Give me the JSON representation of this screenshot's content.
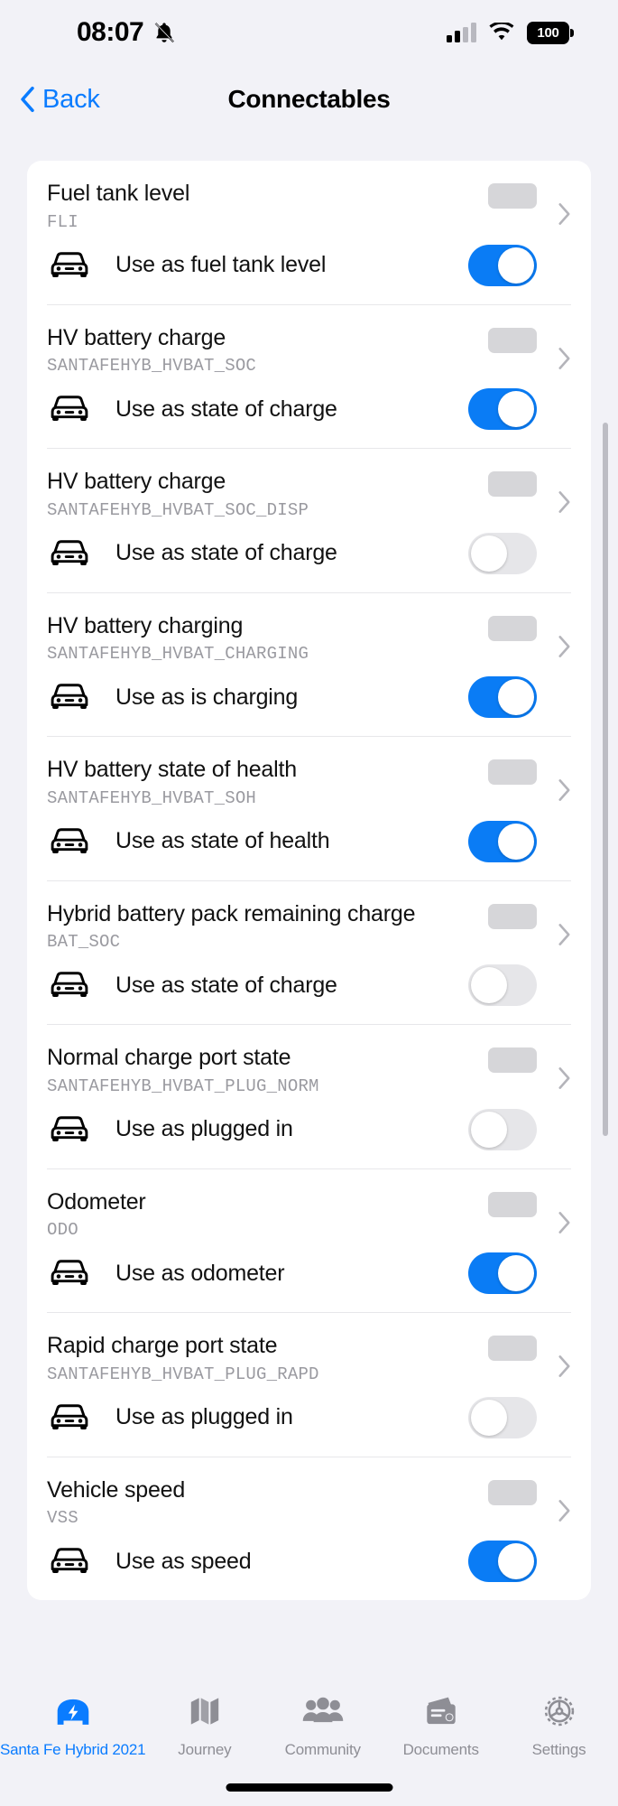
{
  "status_bar": {
    "time": "08:07",
    "bell_icon": "bell-muted-icon",
    "cellular_icon": "cellular-signal-icon",
    "wifi_icon": "wifi-icon",
    "battery_level": "100"
  },
  "nav": {
    "back_label": "Back",
    "back_icon": "chevron-left-icon",
    "title": "Connectables"
  },
  "colors": {
    "accent": "#0a7cff",
    "toggle_on": "#0a7cf5",
    "toggle_off": "#e6e6e9",
    "page_background": "#f2f2f7",
    "card_background": "#ffffff",
    "code_text": "#9a9aa0",
    "skeleton": "#d6d6d9"
  },
  "list": {
    "entries": [
      {
        "title": "Fuel tank level",
        "code": "FLI",
        "row_icon": "car-front-icon",
        "row_label": "Use as fuel tank level",
        "toggle": "on",
        "chevron": "chevron-right-icon"
      },
      {
        "title": "HV battery charge",
        "code": "SANTAFEHYB_HVBAT_SOC",
        "row_icon": "car-front-icon",
        "row_label": "Use as state of charge",
        "toggle": "on",
        "chevron": "chevron-right-icon"
      },
      {
        "title": "HV battery charge",
        "code": "SANTAFEHYB_HVBAT_SOC_DISP",
        "row_icon": "car-front-icon",
        "row_label": "Use as state of charge",
        "toggle": "off",
        "chevron": "chevron-right-icon"
      },
      {
        "title": "HV battery charging",
        "code": "SANTAFEHYB_HVBAT_CHARGING",
        "row_icon": "car-front-icon",
        "row_label": "Use as is charging",
        "toggle": "on",
        "chevron": "chevron-right-icon"
      },
      {
        "title": "HV battery state of health",
        "code": "SANTAFEHYB_HVBAT_SOH",
        "row_icon": "car-front-icon",
        "row_label": "Use as state of health",
        "toggle": "on",
        "chevron": "chevron-right-icon"
      },
      {
        "title": "Hybrid battery pack remaining charge",
        "code": "BAT_SOC",
        "row_icon": "car-front-icon",
        "row_label": "Use as state of charge",
        "toggle": "off",
        "chevron": "chevron-right-icon"
      },
      {
        "title": "Normal charge port state",
        "code": "SANTAFEHYB_HVBAT_PLUG_NORM",
        "row_icon": "car-front-icon",
        "row_label": "Use as plugged in",
        "toggle": "off",
        "chevron": "chevron-right-icon"
      },
      {
        "title": "Odometer",
        "code": "ODO",
        "row_icon": "car-front-icon",
        "row_label": "Use as odometer",
        "toggle": "on",
        "chevron": "chevron-right-icon"
      },
      {
        "title": "Rapid charge port state",
        "code": "SANTAFEHYB_HVBAT_PLUG_RAPD",
        "row_icon": "car-front-icon",
        "row_label": "Use as plugged in",
        "toggle": "off",
        "chevron": "chevron-right-icon"
      },
      {
        "title": "Vehicle speed",
        "code": "VSS",
        "row_icon": "car-front-icon",
        "row_label": "Use as speed",
        "toggle": "on",
        "chevron": "chevron-right-icon"
      }
    ]
  },
  "tab_bar": {
    "tabs": [
      {
        "label": "Santa Fe Hybrid 2021",
        "icon": "car-bolt-icon",
        "active": true
      },
      {
        "label": "Journey",
        "icon": "map-icon",
        "active": false
      },
      {
        "label": "Community",
        "icon": "people-icon",
        "active": false
      },
      {
        "label": "Documents",
        "icon": "documents-icon",
        "active": false
      },
      {
        "label": "Settings",
        "icon": "gear-icon",
        "active": false
      }
    ]
  }
}
